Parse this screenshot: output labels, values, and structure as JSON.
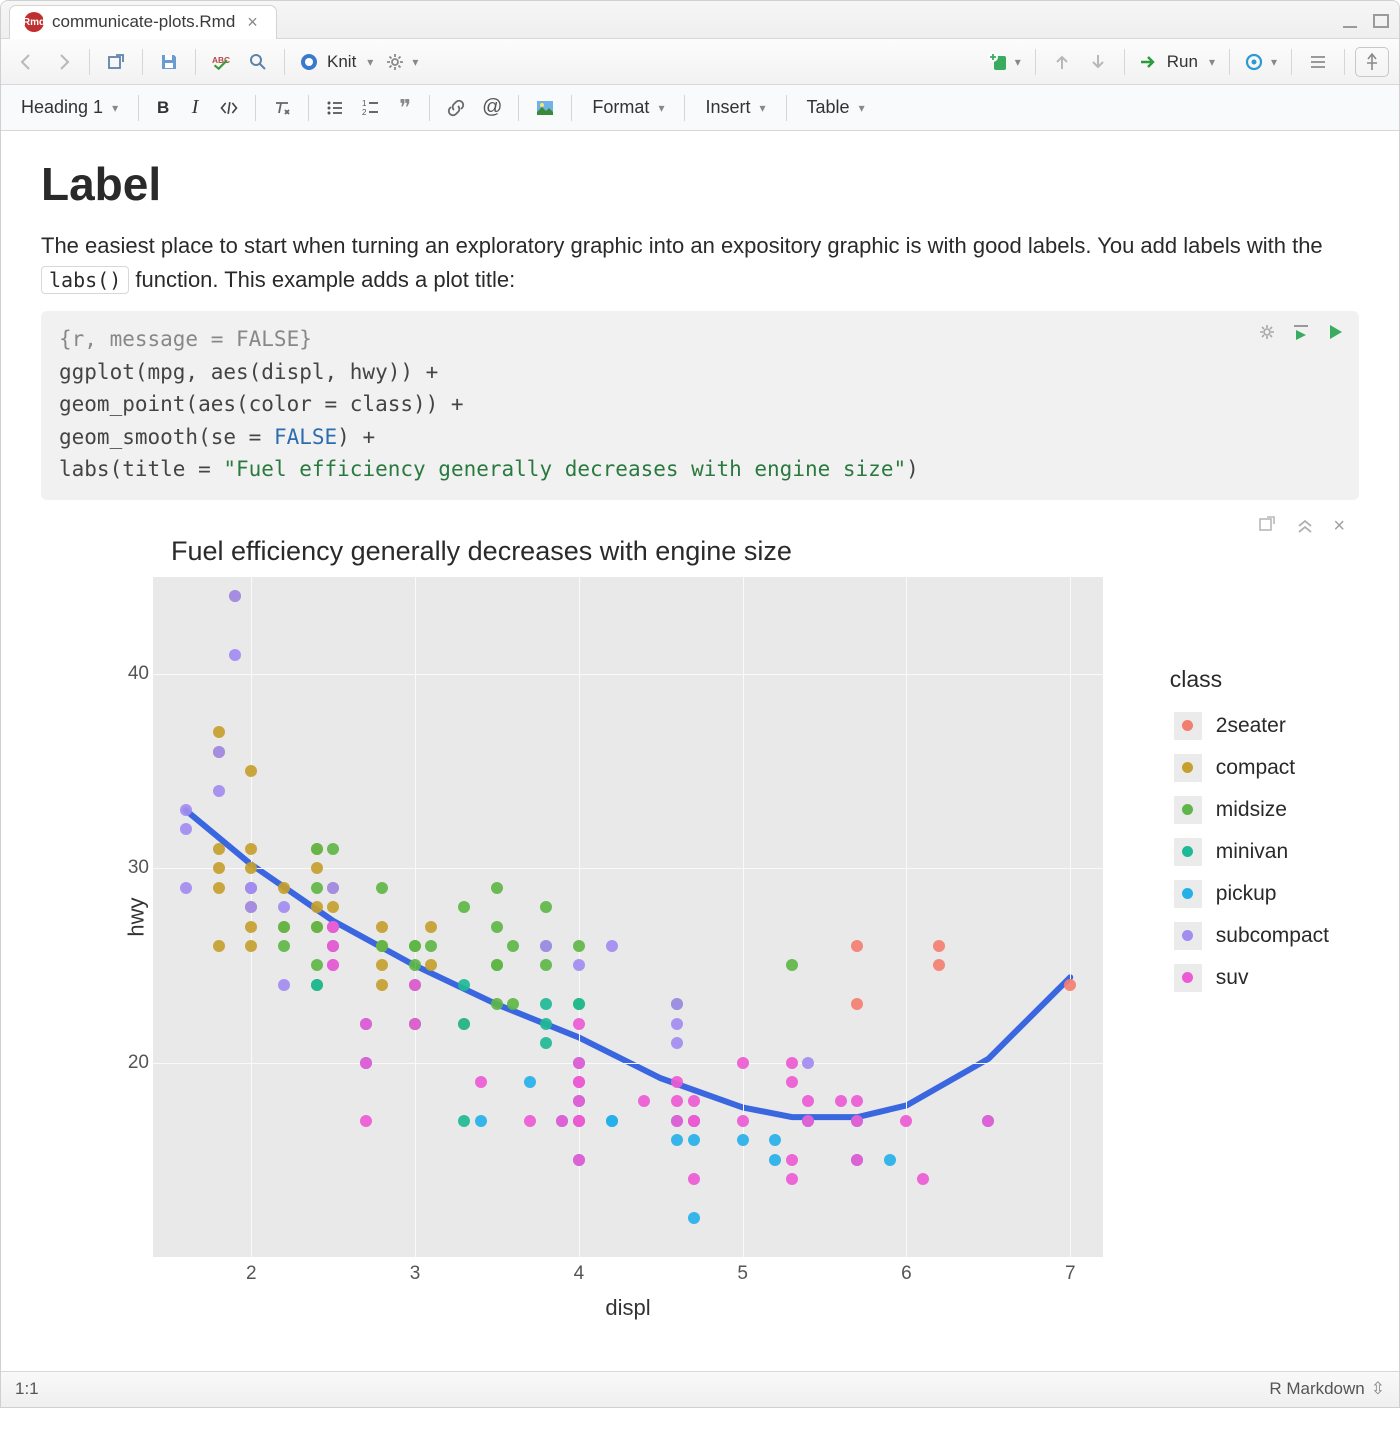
{
  "tab": {
    "filename": "communicate-plots.Rmd"
  },
  "toolbar": {
    "knit_label": "Knit",
    "run_label": "Run"
  },
  "fmtbar": {
    "style_select": "Heading 1",
    "format_label": "Format",
    "insert_label": "Insert",
    "table_label": "Table"
  },
  "document": {
    "heading": "Label",
    "para_before": "The easiest place to start when turning an exploratory graphic into an expository graphic is with good labels. You add labels with the ",
    "inline_code": "labs()",
    "para_after": " function. This example adds a plot title:"
  },
  "chunk": {
    "header": "{r, message = FALSE}",
    "line1_a": "ggplot(mpg, aes(displ, hwy)) +",
    "line2_a": "  geom_point(aes(color = class)) +",
    "line3_a": "  geom_smooth(se = ",
    "line3_const": "FALSE",
    "line3_b": ") +",
    "line4_a": "  labs(title = ",
    "line4_str": "\"Fuel efficiency generally decreases with engine size\"",
    "line4_b": ")"
  },
  "chart_data": {
    "type": "scatter",
    "title": "Fuel efficiency generally decreases with engine size",
    "xlabel": "displ",
    "ylabel": "hwy",
    "xlim": [
      1.4,
      7.2
    ],
    "ylim": [
      10,
      45
    ],
    "x_ticks": [
      2,
      3,
      4,
      5,
      6,
      7
    ],
    "y_ticks": [
      20,
      30,
      40
    ],
    "legend_title": "class",
    "classes": [
      {
        "name": "2seater",
        "color": "#f27e70"
      },
      {
        "name": "compact",
        "color": "#c6a02e"
      },
      {
        "name": "midsize",
        "color": "#5fb648"
      },
      {
        "name": "minivan",
        "color": "#1fb995"
      },
      {
        "name": "pickup",
        "color": "#25b0e8"
      },
      {
        "name": "subcompact",
        "color": "#a28cf0"
      },
      {
        "name": "suv",
        "color": "#ec5bd2"
      }
    ],
    "points": [
      {
        "x": 5.7,
        "y": 26,
        "c": "2seater"
      },
      {
        "x": 5.7,
        "y": 23,
        "c": "2seater"
      },
      {
        "x": 6.2,
        "y": 26,
        "c": "2seater"
      },
      {
        "x": 6.2,
        "y": 25,
        "c": "2seater"
      },
      {
        "x": 7.0,
        "y": 24,
        "c": "2seater"
      },
      {
        "x": 1.8,
        "y": 29,
        "c": "compact"
      },
      {
        "x": 1.8,
        "y": 31,
        "c": "compact"
      },
      {
        "x": 2.0,
        "y": 30,
        "c": "compact"
      },
      {
        "x": 2.0,
        "y": 31,
        "c": "compact"
      },
      {
        "x": 2.8,
        "y": 26,
        "c": "compact"
      },
      {
        "x": 2.8,
        "y": 27,
        "c": "compact"
      },
      {
        "x": 3.1,
        "y": 27,
        "c": "compact"
      },
      {
        "x": 1.8,
        "y": 26,
        "c": "compact"
      },
      {
        "x": 2.0,
        "y": 28,
        "c": "compact"
      },
      {
        "x": 2.0,
        "y": 29,
        "c": "compact"
      },
      {
        "x": 2.4,
        "y": 27,
        "c": "compact"
      },
      {
        "x": 2.4,
        "y": 30,
        "c": "compact"
      },
      {
        "x": 3.1,
        "y": 25,
        "c": "compact"
      },
      {
        "x": 2.4,
        "y": 31,
        "c": "compact"
      },
      {
        "x": 3.3,
        "y": 22,
        "c": "compact"
      },
      {
        "x": 2.0,
        "y": 26,
        "c": "compact"
      },
      {
        "x": 2.2,
        "y": 27,
        "c": "compact"
      },
      {
        "x": 2.2,
        "y": 29,
        "c": "compact"
      },
      {
        "x": 2.4,
        "y": 28,
        "c": "compact"
      },
      {
        "x": 2.5,
        "y": 28,
        "c": "compact"
      },
      {
        "x": 2.5,
        "y": 29,
        "c": "compact"
      },
      {
        "x": 1.8,
        "y": 36,
        "c": "compact"
      },
      {
        "x": 1.8,
        "y": 37,
        "c": "compact"
      },
      {
        "x": 2.0,
        "y": 35,
        "c": "compact"
      },
      {
        "x": 2.8,
        "y": 24,
        "c": "compact"
      },
      {
        "x": 1.9,
        "y": 44,
        "c": "compact"
      },
      {
        "x": 2.5,
        "y": 27,
        "c": "compact"
      },
      {
        "x": 2.8,
        "y": 25,
        "c": "compact"
      },
      {
        "x": 2.0,
        "y": 29,
        "c": "compact"
      },
      {
        "x": 2.0,
        "y": 27,
        "c": "compact"
      },
      {
        "x": 1.8,
        "y": 30,
        "c": "compact"
      },
      {
        "x": 2.4,
        "y": 24,
        "c": "midsize"
      },
      {
        "x": 3.5,
        "y": 25,
        "c": "midsize"
      },
      {
        "x": 2.5,
        "y": 26,
        "c": "midsize"
      },
      {
        "x": 3.5,
        "y": 29,
        "c": "midsize"
      },
      {
        "x": 3.0,
        "y": 26,
        "c": "midsize"
      },
      {
        "x": 3.0,
        "y": 25,
        "c": "midsize"
      },
      {
        "x": 3.5,
        "y": 27,
        "c": "midsize"
      },
      {
        "x": 3.1,
        "y": 26,
        "c": "midsize"
      },
      {
        "x": 3.8,
        "y": 26,
        "c": "midsize"
      },
      {
        "x": 3.8,
        "y": 28,
        "c": "midsize"
      },
      {
        "x": 2.4,
        "y": 31,
        "c": "midsize"
      },
      {
        "x": 2.5,
        "y": 31,
        "c": "midsize"
      },
      {
        "x": 3.3,
        "y": 28,
        "c": "midsize"
      },
      {
        "x": 3.5,
        "y": 25,
        "c": "midsize"
      },
      {
        "x": 3.8,
        "y": 25,
        "c": "midsize"
      },
      {
        "x": 5.3,
        "y": 25,
        "c": "midsize"
      },
      {
        "x": 2.2,
        "y": 26,
        "c": "midsize"
      },
      {
        "x": 2.2,
        "y": 27,
        "c": "midsize"
      },
      {
        "x": 2.4,
        "y": 29,
        "c": "midsize"
      },
      {
        "x": 3.0,
        "y": 22,
        "c": "midsize"
      },
      {
        "x": 3.6,
        "y": 26,
        "c": "midsize"
      },
      {
        "x": 2.4,
        "y": 27,
        "c": "midsize"
      },
      {
        "x": 2.4,
        "y": 25,
        "c": "midsize"
      },
      {
        "x": 4.6,
        "y": 23,
        "c": "midsize"
      },
      {
        "x": 3.0,
        "y": 26,
        "c": "midsize"
      },
      {
        "x": 2.8,
        "y": 29,
        "c": "midsize"
      },
      {
        "x": 3.6,
        "y": 23,
        "c": "midsize"
      },
      {
        "x": 4.0,
        "y": 26,
        "c": "midsize"
      },
      {
        "x": 4.0,
        "y": 23,
        "c": "midsize"
      },
      {
        "x": 2.8,
        "y": 26,
        "c": "midsize"
      },
      {
        "x": 3.5,
        "y": 23,
        "c": "midsize"
      },
      {
        "x": 2.4,
        "y": 24,
        "c": "minivan"
      },
      {
        "x": 3.0,
        "y": 24,
        "c": "minivan"
      },
      {
        "x": 3.3,
        "y": 22,
        "c": "minivan"
      },
      {
        "x": 3.3,
        "y": 24,
        "c": "minivan"
      },
      {
        "x": 3.8,
        "y": 22,
        "c": "minivan"
      },
      {
        "x": 3.8,
        "y": 23,
        "c": "minivan"
      },
      {
        "x": 4.0,
        "y": 23,
        "c": "minivan"
      },
      {
        "x": 3.3,
        "y": 17,
        "c": "minivan"
      },
      {
        "x": 3.8,
        "y": 21,
        "c": "minivan"
      },
      {
        "x": 3.0,
        "y": 22,
        "c": "minivan"
      },
      {
        "x": 3.7,
        "y": 19,
        "c": "pickup"
      },
      {
        "x": 3.9,
        "y": 17,
        "c": "pickup"
      },
      {
        "x": 4.7,
        "y": 12,
        "c": "pickup"
      },
      {
        "x": 4.7,
        "y": 17,
        "c": "pickup"
      },
      {
        "x": 4.7,
        "y": 16,
        "c": "pickup"
      },
      {
        "x": 5.2,
        "y": 15,
        "c": "pickup"
      },
      {
        "x": 5.2,
        "y": 16,
        "c": "pickup"
      },
      {
        "x": 5.7,
        "y": 17,
        "c": "pickup"
      },
      {
        "x": 5.9,
        "y": 15,
        "c": "pickup"
      },
      {
        "x": 4.2,
        "y": 17,
        "c": "pickup"
      },
      {
        "x": 4.2,
        "y": 17,
        "c": "pickup"
      },
      {
        "x": 4.6,
        "y": 16,
        "c": "pickup"
      },
      {
        "x": 4.6,
        "y": 17,
        "c": "pickup"
      },
      {
        "x": 5.4,
        "y": 17,
        "c": "pickup"
      },
      {
        "x": 2.7,
        "y": 20,
        "c": "pickup"
      },
      {
        "x": 2.7,
        "y": 22,
        "c": "pickup"
      },
      {
        "x": 3.4,
        "y": 17,
        "c": "pickup"
      },
      {
        "x": 4.0,
        "y": 17,
        "c": "pickup"
      },
      {
        "x": 4.0,
        "y": 20,
        "c": "pickup"
      },
      {
        "x": 4.7,
        "y": 17,
        "c": "pickup"
      },
      {
        "x": 4.0,
        "y": 15,
        "c": "pickup"
      },
      {
        "x": 4.0,
        "y": 18,
        "c": "pickup"
      },
      {
        "x": 5.7,
        "y": 15,
        "c": "pickup"
      },
      {
        "x": 5.0,
        "y": 16,
        "c": "pickup"
      },
      {
        "x": 6.5,
        "y": 17,
        "c": "pickup"
      },
      {
        "x": 1.6,
        "y": 33,
        "c": "subcompact"
      },
      {
        "x": 1.6,
        "y": 29,
        "c": "subcompact"
      },
      {
        "x": 1.6,
        "y": 32,
        "c": "subcompact"
      },
      {
        "x": 1.8,
        "y": 34,
        "c": "subcompact"
      },
      {
        "x": 1.8,
        "y": 36,
        "c": "subcompact"
      },
      {
        "x": 2.0,
        "y": 29,
        "c": "subcompact"
      },
      {
        "x": 2.0,
        "y": 28,
        "c": "subcompact"
      },
      {
        "x": 2.5,
        "y": 25,
        "c": "subcompact"
      },
      {
        "x": 2.5,
        "y": 26,
        "c": "subcompact"
      },
      {
        "x": 2.2,
        "y": 24,
        "c": "subcompact"
      },
      {
        "x": 2.2,
        "y": 28,
        "c": "subcompact"
      },
      {
        "x": 2.5,
        "y": 27,
        "c": "subcompact"
      },
      {
        "x": 1.9,
        "y": 44,
        "c": "subcompact"
      },
      {
        "x": 1.9,
        "y": 41,
        "c": "subcompact"
      },
      {
        "x": 2.0,
        "y": 29,
        "c": "subcompact"
      },
      {
        "x": 2.5,
        "y": 29,
        "c": "subcompact"
      },
      {
        "x": 3.8,
        "y": 26,
        "c": "subcompact"
      },
      {
        "x": 4.0,
        "y": 25,
        "c": "subcompact"
      },
      {
        "x": 4.6,
        "y": 23,
        "c": "subcompact"
      },
      {
        "x": 4.6,
        "y": 22,
        "c": "subcompact"
      },
      {
        "x": 5.4,
        "y": 20,
        "c": "subcompact"
      },
      {
        "x": 4.2,
        "y": 26,
        "c": "subcompact"
      },
      {
        "x": 4.6,
        "y": 21,
        "c": "subcompact"
      },
      {
        "x": 5.3,
        "y": 20,
        "c": "suv"
      },
      {
        "x": 5.3,
        "y": 15,
        "c": "suv"
      },
      {
        "x": 5.7,
        "y": 17,
        "c": "suv"
      },
      {
        "x": 6.0,
        "y": 17,
        "c": "suv"
      },
      {
        "x": 5.7,
        "y": 18,
        "c": "suv"
      },
      {
        "x": 5.3,
        "y": 14,
        "c": "suv"
      },
      {
        "x": 5.3,
        "y": 19,
        "c": "suv"
      },
      {
        "x": 6.5,
        "y": 17,
        "c": "suv"
      },
      {
        "x": 4.7,
        "y": 17,
        "c": "suv"
      },
      {
        "x": 4.0,
        "y": 17,
        "c": "suv"
      },
      {
        "x": 4.0,
        "y": 18,
        "c": "suv"
      },
      {
        "x": 4.0,
        "y": 19,
        "c": "suv"
      },
      {
        "x": 3.7,
        "y": 17,
        "c": "suv"
      },
      {
        "x": 3.9,
        "y": 17,
        "c": "suv"
      },
      {
        "x": 4.0,
        "y": 19,
        "c": "suv"
      },
      {
        "x": 4.6,
        "y": 17,
        "c": "suv"
      },
      {
        "x": 5.0,
        "y": 17,
        "c": "suv"
      },
      {
        "x": 5.4,
        "y": 17,
        "c": "suv"
      },
      {
        "x": 3.0,
        "y": 22,
        "c": "suv"
      },
      {
        "x": 4.0,
        "y": 22,
        "c": "suv"
      },
      {
        "x": 4.4,
        "y": 18,
        "c": "suv"
      },
      {
        "x": 4.6,
        "y": 18,
        "c": "suv"
      },
      {
        "x": 5.4,
        "y": 18,
        "c": "suv"
      },
      {
        "x": 4.0,
        "y": 17,
        "c": "suv"
      },
      {
        "x": 4.7,
        "y": 18,
        "c": "suv"
      },
      {
        "x": 4.7,
        "y": 14,
        "c": "suv"
      },
      {
        "x": 5.7,
        "y": 15,
        "c": "suv"
      },
      {
        "x": 6.1,
        "y": 14,
        "c": "suv"
      },
      {
        "x": 4.0,
        "y": 15,
        "c": "suv"
      },
      {
        "x": 3.0,
        "y": 24,
        "c": "suv"
      },
      {
        "x": 4.6,
        "y": 19,
        "c": "suv"
      },
      {
        "x": 5.0,
        "y": 20,
        "c": "suv"
      },
      {
        "x": 2.7,
        "y": 20,
        "c": "suv"
      },
      {
        "x": 2.7,
        "y": 17,
        "c": "suv"
      },
      {
        "x": 3.4,
        "y": 19,
        "c": "suv"
      },
      {
        "x": 4.7,
        "y": 17,
        "c": "suv"
      },
      {
        "x": 2.5,
        "y": 27,
        "c": "suv"
      },
      {
        "x": 2.5,
        "y": 25,
        "c": "suv"
      },
      {
        "x": 2.7,
        "y": 22,
        "c": "suv"
      },
      {
        "x": 4.0,
        "y": 20,
        "c": "suv"
      },
      {
        "x": 2.5,
        "y": 26,
        "c": "suv"
      },
      {
        "x": 5.6,
        "y": 18,
        "c": "suv"
      }
    ],
    "smooth_line": [
      {
        "x": 1.6,
        "y": 33
      },
      {
        "x": 2.0,
        "y": 30.2
      },
      {
        "x": 2.5,
        "y": 27.3
      },
      {
        "x": 3.0,
        "y": 25
      },
      {
        "x": 3.5,
        "y": 23
      },
      {
        "x": 4.0,
        "y": 21.3
      },
      {
        "x": 4.5,
        "y": 19.2
      },
      {
        "x": 5.0,
        "y": 17.7
      },
      {
        "x": 5.3,
        "y": 17.2
      },
      {
        "x": 5.7,
        "y": 17.2
      },
      {
        "x": 6.0,
        "y": 17.8
      },
      {
        "x": 6.5,
        "y": 20.2
      },
      {
        "x": 7.0,
        "y": 24.4
      }
    ]
  },
  "statusbar": {
    "pos": "1:1",
    "mode": "R Markdown"
  }
}
